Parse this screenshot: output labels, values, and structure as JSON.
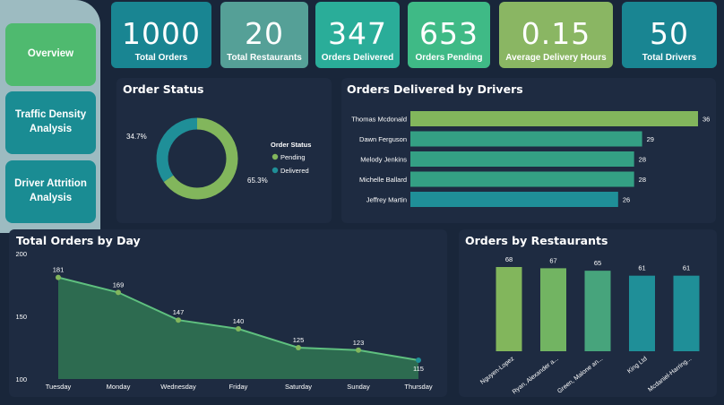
{
  "nav": {
    "items": [
      {
        "label": "Overview",
        "color": "#4fba6f"
      },
      {
        "label": "Traffic Density Analysis",
        "color": "#1a8c93"
      },
      {
        "label": "Driver Attrition Analysis",
        "color": "#1a8c93"
      }
    ]
  },
  "kpis": [
    {
      "value": "1000",
      "label": "Total Orders",
      "color": "#198592"
    },
    {
      "value": "20",
      "label": "Total Restaurants",
      "color": "#55a097"
    },
    {
      "value": "347",
      "label": "Orders Delivered",
      "color": "#2aad99"
    },
    {
      "value": "653",
      "label": "Orders Pending",
      "color": "#3fba86"
    },
    {
      "value": "0.15",
      "label": "Average Delivery Hours",
      "color": "#8ab663"
    },
    {
      "value": "50",
      "label": "Total Drivers",
      "color": "#198592"
    }
  ],
  "colors": {
    "green": "#82b65c",
    "teal": "#1f8f98",
    "midteal": "#34a084",
    "area": "#2d6b50",
    "line": "#5fc07f"
  },
  "chart_data": [
    {
      "type": "pie",
      "title": "Order Status",
      "legend_title": "Order Status",
      "legend_position": "right",
      "categories": [
        "Pending",
        "Delivered"
      ],
      "values": [
        65.3,
        34.7
      ],
      "value_labels": [
        "65.3%",
        "34.7%"
      ]
    },
    {
      "type": "bar",
      "orientation": "horizontal",
      "title": "Orders Delivered by Drivers",
      "categories": [
        "Thomas Mcdonald",
        "Dawn Ferguson",
        "Melody Jenkins",
        "Michelle Ballard",
        "Jeffrey Martin"
      ],
      "values": [
        36,
        29,
        28,
        28,
        26
      ]
    },
    {
      "type": "area",
      "title": "Total Orders by Day",
      "categories": [
        "Tuesday",
        "Monday",
        "Wednesday",
        "Friday",
        "Saturday",
        "Sunday",
        "Thursday"
      ],
      "values": [
        181,
        169,
        147,
        140,
        125,
        123,
        115
      ],
      "ylim": [
        100,
        200
      ],
      "yticks": [
        100,
        150,
        200
      ]
    },
    {
      "type": "bar",
      "title": "Orders by Restaurants",
      "categories": [
        "Nguyen-Lopez",
        "Ryan, Alexander a...",
        "Green, Malone an...",
        "King Ltd",
        "Mcdaniel-Harring..."
      ],
      "values": [
        68,
        67,
        65,
        61,
        61
      ]
    }
  ]
}
